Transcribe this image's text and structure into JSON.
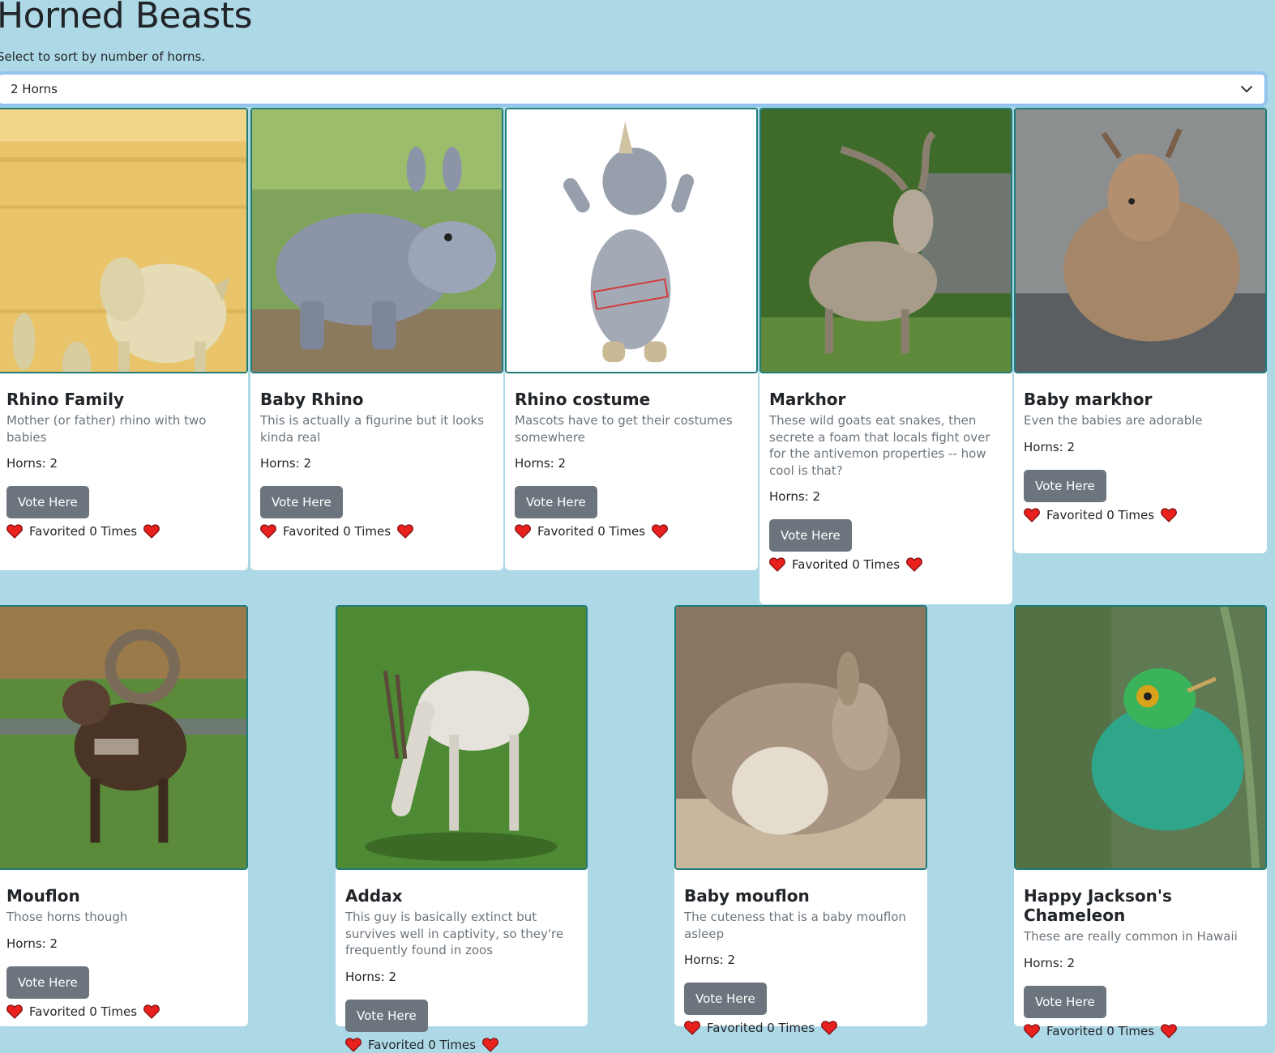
{
  "header": {
    "title": "Horned Beasts",
    "subtitle": "Select to sort by number of horns."
  },
  "filter": {
    "selected": "2 Horns"
  },
  "cards": [
    {
      "title": "Rhino Family",
      "description": "Mother (or father) rhino with two babies",
      "horns": "Horns: 2",
      "vote_label": "Vote Here",
      "favorited": "Favorited 0 Times"
    },
    {
      "title": "Baby Rhino",
      "description": "This is actually a figurine but it looks kinda real",
      "horns": "Horns: 2",
      "vote_label": "Vote Here",
      "favorited": "Favorited 0 Times"
    },
    {
      "title": "Rhino costume",
      "description": "Mascots have to get their costumes somewhere",
      "horns": "Horns: 2",
      "vote_label": "Vote Here",
      "favorited": "Favorited 0 Times"
    },
    {
      "title": "Markhor",
      "description": "These wild goats eat snakes, then secrete a foam that locals fight over for the antivemon properties -- how cool is that?",
      "horns": "Horns: 2",
      "vote_label": "Vote Here",
      "favorited": "Favorited 0 Times"
    },
    {
      "title": "Baby markhor",
      "description": "Even the babies are adorable",
      "horns": "Horns: 2",
      "vote_label": "Vote Here",
      "favorited": "Favorited 0 Times"
    },
    {
      "title": "Mouflon",
      "description": "Those horns though",
      "horns": "Horns: 2",
      "vote_label": "Vote Here",
      "favorited": "Favorited 0 Times"
    },
    {
      "title": "Addax",
      "description": "This guy is basically extinct but survives well in captivity, so they're frequently found in zoos",
      "horns": "Horns: 2",
      "vote_label": "Vote Here",
      "favorited": "Favorited 0 Times"
    },
    {
      "title": "Baby mouflon",
      "description": "The cuteness that is a baby mouflon asleep",
      "horns": "Horns: 2",
      "vote_label": "Vote Here",
      "favorited": "Favorited 0 Times"
    },
    {
      "title": "Happy Jackson's Chameleon",
      "description": "These are really common in Hawaii",
      "horns": "Horns: 2",
      "vote_label": "Vote Here",
      "favorited": "Favorited 0 Times"
    }
  ],
  "colors": {
    "page_bg": "#add8e6",
    "image_border": "#1f7c7a",
    "vote_button": "#6c757d",
    "heart": "#e8201e"
  },
  "icons": {
    "select": "chevron-down-icon",
    "favorite": "heart-icon"
  }
}
